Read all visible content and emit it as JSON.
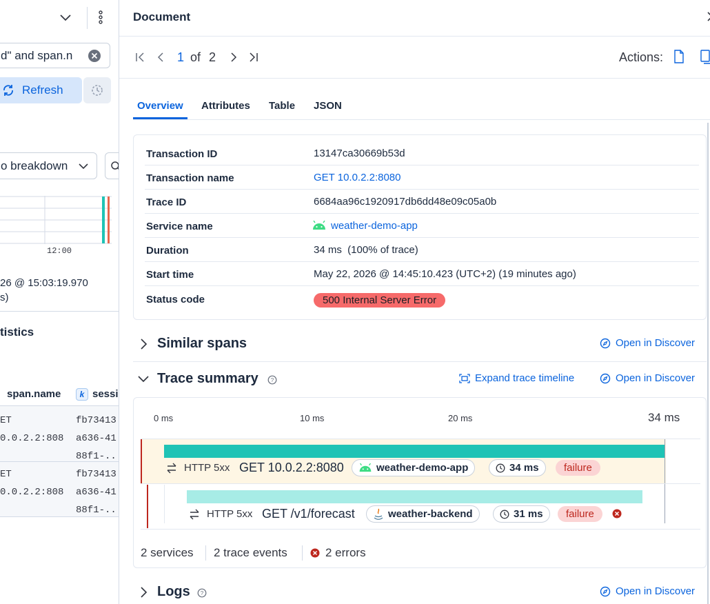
{
  "left_panel": {
    "query_text": "d\" and span.n",
    "refresh_label": "Refresh",
    "breakdown_label": "o breakdown",
    "chart_tick": "12:00",
    "timestamp_line1": "26 @ 15:03:19.970",
    "timestamp_line2": "s)",
    "stats_heading": "tistics",
    "columns": [
      "span.name",
      "sessi"
    ],
    "column_badge": "k",
    "rows": [
      {
        "c0_l1": "ET",
        "c0_l2": "0.0.2.2:808",
        "c1_l1": "fb73413",
        "c1_l2": "a636-41",
        "c1_l3": "88f1-..."
      },
      {
        "c0_l1": "ET",
        "c0_l2": "0.0.2.2:808",
        "c1_l1": "fb73413",
        "c1_l2": "a636-41",
        "c1_l3": "88f1-..."
      }
    ]
  },
  "flyout": {
    "title": "Document",
    "pagination": {
      "current": "1",
      "of_label": "of",
      "total": "2"
    },
    "actions_label": "Actions:",
    "tabs": [
      {
        "label": "Overview",
        "active": true
      },
      {
        "label": "Attributes",
        "active": false
      },
      {
        "label": "Table",
        "active": false
      },
      {
        "label": "JSON",
        "active": false
      }
    ],
    "overview": [
      {
        "label": "Transaction ID",
        "value": "13147ca30669b53d"
      },
      {
        "label": "Transaction name",
        "value": "GET 10.0.2.2:8080"
      },
      {
        "label": "Trace ID",
        "value": "6684aa96c1920917db6dd48e09c05a0b"
      },
      {
        "label": "Service name",
        "value": "weather-demo-app"
      },
      {
        "label": "Duration",
        "value": "34 ms  (100% of trace)"
      },
      {
        "label": "Start time",
        "value": "May 22, 2026 @ 14:45:10.423 (UTC+2) (19 minutes ago)"
      },
      {
        "label": "Status code",
        "value": "500 Internal Server Error"
      }
    ],
    "similar_spans": {
      "title": "Similar spans",
      "link": "Open in Discover"
    },
    "trace_summary": {
      "title": "Trace summary",
      "expand_link": "Expand trace timeline",
      "discover_link": "Open in Discover",
      "ticks": [
        "0 ms",
        "10 ms",
        "20 ms",
        "34 ms"
      ],
      "spans": [
        {
          "kind": "HTTP 5xx",
          "name": "GET 10.0.2.2:8080",
          "service": "weather-demo-app",
          "duration": "34 ms",
          "outcome": "failure",
          "share": 1.0
        },
        {
          "kind": "HTTP 5xx",
          "name": "GET /v1/forecast",
          "service": "weather-backend",
          "duration": "31 ms",
          "outcome": "failure",
          "share": 0.91
        }
      ],
      "footer": {
        "services": "2 services",
        "events": "2 trace events",
        "errors": "2 errors"
      }
    },
    "logs": {
      "title": "Logs",
      "link": "Open in Discover"
    },
    "colors": {
      "accent": "#0b64dd",
      "bar_primary": "#1fc3b5",
      "bar_secondary": "#a7ece6",
      "error": "#bd271e",
      "status_badge": "#f66a6a"
    }
  }
}
